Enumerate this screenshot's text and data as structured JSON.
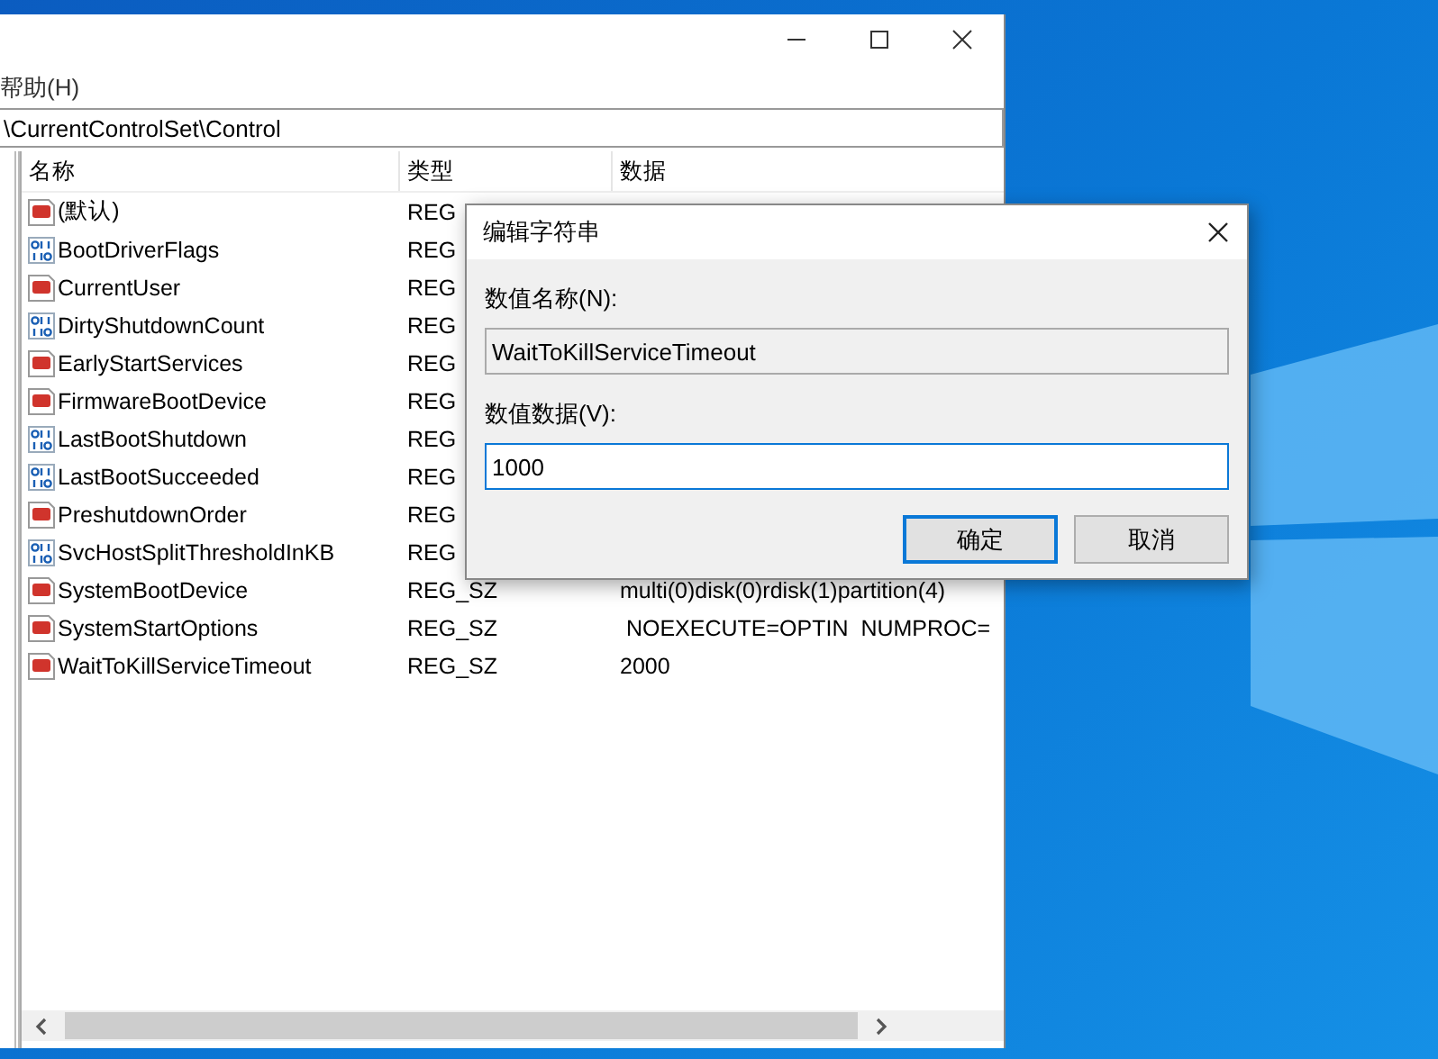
{
  "window": {
    "menu": [
      {
        "label": "帮助(H)"
      }
    ],
    "address": "\\CurrentControlSet\\Control"
  },
  "table": {
    "columns": [
      "名称",
      "类型",
      "数据"
    ],
    "rows": [
      {
        "kind": "sz",
        "name": "(默认)",
        "type": "REG",
        "data": ""
      },
      {
        "kind": "dword",
        "name": "BootDriverFlags",
        "type": "REG",
        "data": ""
      },
      {
        "kind": "sz",
        "name": "CurrentUser",
        "type": "REG",
        "data": ""
      },
      {
        "kind": "dword",
        "name": "DirtyShutdownCount",
        "type": "REG",
        "data": ""
      },
      {
        "kind": "sz",
        "name": "EarlyStartServices",
        "type": "REG",
        "data": ""
      },
      {
        "kind": "sz",
        "name": "FirmwareBootDevice",
        "type": "REG",
        "data": ""
      },
      {
        "kind": "dword",
        "name": "LastBootShutdown",
        "type": "REG",
        "data": ""
      },
      {
        "kind": "dword",
        "name": "LastBootSucceeded",
        "type": "REG",
        "data": ""
      },
      {
        "kind": "sz",
        "name": "PreshutdownOrder",
        "type": "REG",
        "data": ""
      },
      {
        "kind": "dword",
        "name": "SvcHostSplitThresholdInKB",
        "type": "REG",
        "data": ""
      },
      {
        "kind": "sz",
        "name": "SystemBootDevice",
        "type": "REG_SZ",
        "data": "multi(0)disk(0)rdisk(1)partition(4)"
      },
      {
        "kind": "sz",
        "name": "SystemStartOptions",
        "type": "REG_SZ",
        "data": " NOEXECUTE=OPTIN  NUMPROC="
      },
      {
        "kind": "sz",
        "name": "WaitToKillServiceTimeout",
        "type": "REG_SZ",
        "data": "2000"
      }
    ]
  },
  "dialog": {
    "title": "编辑字符串",
    "name_label": "数值名称(N):",
    "name_value": "WaitToKillServiceTimeout",
    "data_label": "数值数据(V):",
    "data_value": "1000",
    "buttons": [
      {
        "label": "确定",
        "default": true
      },
      {
        "label": "取消",
        "default": false
      }
    ]
  }
}
